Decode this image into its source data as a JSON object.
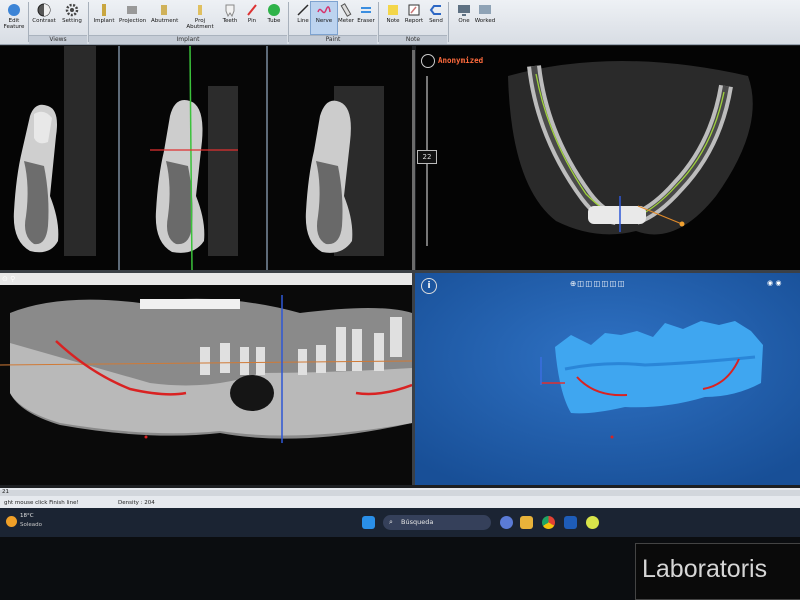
{
  "ribbon": {
    "buttons": {
      "edit": "Edit",
      "edit_sub": "Feature",
      "contrast": "Contrast",
      "setting": "Setting",
      "implant": "Implant",
      "projection": "Projection",
      "abutment": "Abutment",
      "proj_abutment": "Proj Abutment",
      "teeth": "Teeth",
      "pin": "Pin",
      "tube": "Tube",
      "line": "Line",
      "nerve": "Nerve",
      "meter": "Meter",
      "eraser": "Eraser",
      "note": "Note",
      "report": "Report",
      "send": "Send",
      "one": "One",
      "worked": "Worked"
    },
    "groups": {
      "views": "Views",
      "implant": "Implant",
      "paint": "Paint",
      "note": "Note"
    }
  },
  "axial_panel": {
    "anonymized_label": "Anonymized",
    "zoom_value": "22"
  },
  "statusbar": {
    "hint": "ght mouse click Finish line!",
    "density": "Density : 204",
    "left_tag": "21"
  },
  "taskbar": {
    "weather_temp": "18°C",
    "weather_desc": "Soleado",
    "search_placeholder": "Búsqueda"
  },
  "overlay": {
    "lab_text": "Laboratoris"
  },
  "colors": {
    "nerve_red": "#d92222",
    "canal_green": "#9fd23c",
    "crosshair_blue": "#2e57d6",
    "crosshair_red": "#e03030",
    "model_blue": "#2f93e6",
    "viewport_blue": "#1f5fb0"
  }
}
